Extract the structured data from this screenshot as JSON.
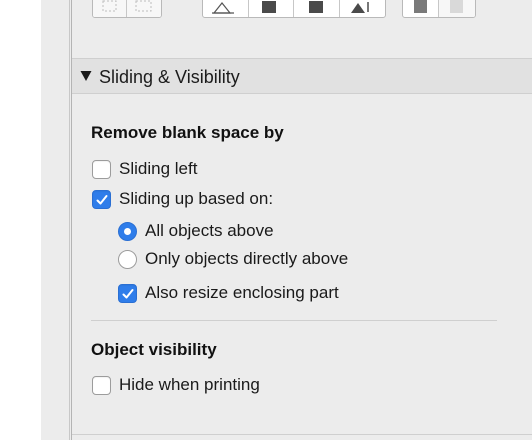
{
  "toolbar": {
    "group1_icons": [
      "group-icon",
      "ungroup-icon"
    ],
    "group2_icons": [
      "align-bottom-icon",
      "bring-to-front-icon",
      "send-to-back-icon",
      "distribute-vertical-icon"
    ],
    "group3_icons": [
      "fill-solid-icon",
      "fill-none-icon"
    ]
  },
  "section": {
    "title": "Sliding & Visibility",
    "expanded": true
  },
  "remove_blank": {
    "heading": "Remove blank space by",
    "sliding_left": {
      "label": "Sliding left",
      "checked": false
    },
    "sliding_up": {
      "label": "Sliding up based on:",
      "checked": true
    },
    "all_objects_above": {
      "label": "All objects above",
      "selected": true
    },
    "only_directly_above": {
      "label": "Only objects directly above",
      "selected": false
    },
    "also_resize": {
      "label": "Also resize enclosing part",
      "checked": true
    }
  },
  "visibility": {
    "heading": "Object visibility",
    "hide_when_printing": {
      "label": "Hide when printing",
      "checked": false
    }
  },
  "colors": {
    "accent": "#2f7dea",
    "panel_bg": "#ececec",
    "header_bg": "#e1e1e1"
  }
}
